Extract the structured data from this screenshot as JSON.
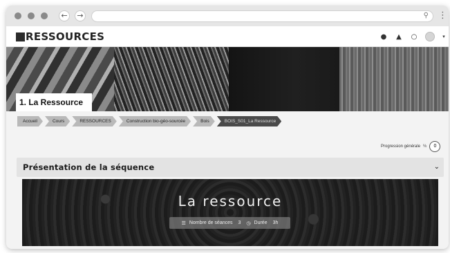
{
  "browser": {
    "back_icon": "arrow-left-icon",
    "forward_icon": "arrow-right-icon",
    "search_icon": "search-icon",
    "menu_icon": "kebab-menu-icon"
  },
  "site": {
    "logo_text": "RESSOURCES",
    "icons": [
      "globe-icon",
      "bell-icon",
      "chat-icon",
      "avatar",
      "caret-down-icon"
    ]
  },
  "page": {
    "title": "1. La Ressource"
  },
  "breadcrumb": [
    {
      "label": "Accueil"
    },
    {
      "label": "Cours"
    },
    {
      "label": "RESSOURCES"
    },
    {
      "label": "Construction bio-géo-sourcée"
    },
    {
      "label": "Bois"
    },
    {
      "label": "BOIS_S01_La Ressource"
    }
  ],
  "progress": {
    "label": "Progression générale",
    "help": "%",
    "value": "0"
  },
  "section": {
    "title": "Présentation de la séquence",
    "toggle_icon": "chevron-down-icon"
  },
  "hero": {
    "title": "La ressource",
    "sessions_label": "Nombre de séances",
    "sessions_value": "3",
    "duration_label": "Durée",
    "duration_value": "3h"
  }
}
